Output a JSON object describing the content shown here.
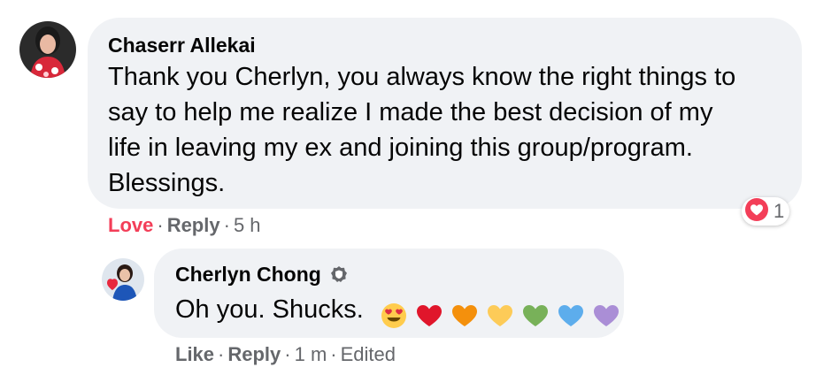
{
  "comment": {
    "author": "Chaserr Allekai",
    "lines": [
      "Thank you Cherlyn, you always know the right things to",
      "say to help me realize I made the best decision of my",
      "life in leaving my ex and joining this group/program.",
      "Blessings."
    ],
    "actions": {
      "love": "Love",
      "reply": "Reply",
      "time": "5 h"
    },
    "reaction_count": "1"
  },
  "reply": {
    "author": "Cherlyn Chong",
    "text": "Oh you. Shucks.",
    "emojis": [
      "heart-eyes-emoji",
      "red-heart-emoji",
      "orange-heart-emoji",
      "yellow-heart-emoji",
      "green-heart-emoji",
      "blue-heart-emoji",
      "purple-heart-emoji"
    ],
    "actions": {
      "like": "Like",
      "reply": "Reply",
      "time": "1 m",
      "edited": "Edited"
    }
  },
  "colors": {
    "bubble": "#f0f2f5",
    "love": "#f33e58",
    "meta": "#65676b",
    "heart_red": "#e0162b",
    "heart_orange": "#f4900c",
    "heart_yellow": "#fdcb58",
    "heart_green": "#78b159",
    "heart_blue": "#5dadec",
    "heart_purple": "#aa8ed6"
  }
}
